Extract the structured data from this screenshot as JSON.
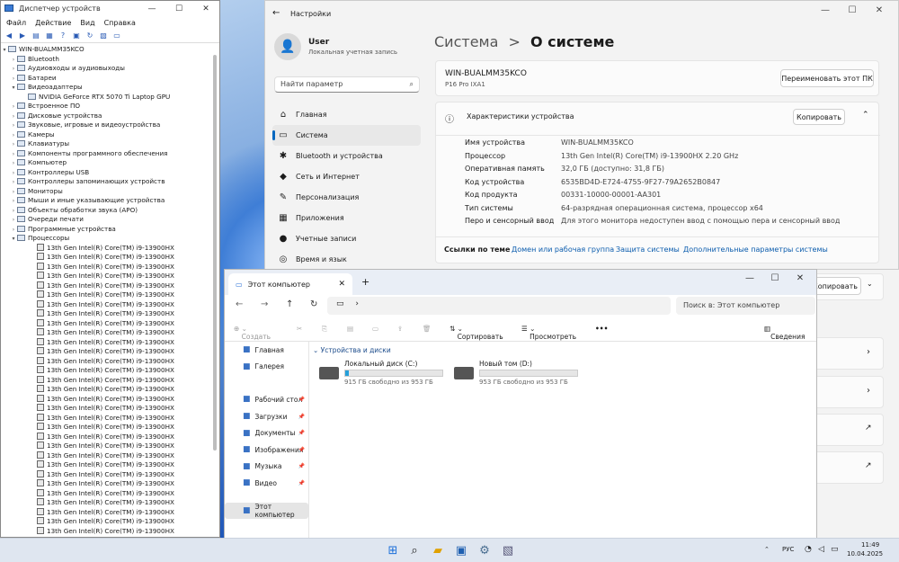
{
  "device_manager": {
    "title": "Диспетчер устройств",
    "menu": [
      "Файл",
      "Действие",
      "Вид",
      "Справка"
    ],
    "root": "WIN-BUALMM35KCO",
    "categories": [
      {
        "label": "Bluetooth",
        "expanded": false
      },
      {
        "label": "Аудиовходы и аудиовыходы",
        "expanded": false
      },
      {
        "label": "Батареи",
        "expanded": false
      },
      {
        "label": "Видеоадаптеры",
        "expanded": true
      },
      {
        "label": "NVIDIA GeForce RTX 5070 Ti Laptop GPU",
        "child": true
      },
      {
        "label": "Встроенное ПО",
        "expanded": false
      },
      {
        "label": "Дисковые устройства",
        "expanded": false
      },
      {
        "label": "Звуковые, игровые и видеоустройства",
        "expanded": false
      },
      {
        "label": "Камеры",
        "expanded": false
      },
      {
        "label": "Клавиатуры",
        "expanded": false
      },
      {
        "label": "Компоненты программного обеспечения",
        "expanded": false
      },
      {
        "label": "Компьютер",
        "expanded": false
      },
      {
        "label": "Контроллеры USB",
        "expanded": false
      },
      {
        "label": "Контроллеры запоминающих устройств",
        "expanded": false
      },
      {
        "label": "Мониторы",
        "expanded": false
      },
      {
        "label": "Мыши и иные указывающие устройства",
        "expanded": false
      },
      {
        "label": "Объекты обработки звука (APO)",
        "expanded": false
      },
      {
        "label": "Очереди печати",
        "expanded": false
      },
      {
        "label": "Программные устройства",
        "expanded": false
      },
      {
        "label": "Процессоры",
        "expanded": true
      }
    ],
    "processor_label": "13th Gen Intel(R) Core(TM) i9-13900HX",
    "processor_count": 31
  },
  "settings": {
    "window_title": "Настройки",
    "user_name": "User",
    "user_role": "Локальная учетная запись",
    "search_placeholder": "Найти параметр",
    "nav": [
      {
        "label": "Главная",
        "icon": "home-icon",
        "glyph": "⌂",
        "active": false
      },
      {
        "label": "Система",
        "icon": "system-icon",
        "glyph": "▭",
        "active": true
      },
      {
        "label": "Bluetooth и устройства",
        "icon": "bluetooth-icon",
        "glyph": "✱",
        "active": false
      },
      {
        "label": "Сеть и Интернет",
        "icon": "network-icon",
        "glyph": "◆",
        "active": false
      },
      {
        "label": "Персонализация",
        "icon": "brush-icon",
        "glyph": "✎",
        "active": false
      },
      {
        "label": "Приложения",
        "icon": "apps-icon",
        "glyph": "▦",
        "active": false
      },
      {
        "label": "Учетные записи",
        "icon": "account-icon",
        "glyph": "●",
        "active": false
      },
      {
        "label": "Время и язык",
        "icon": "globe-icon",
        "glyph": "◎",
        "active": false
      }
    ],
    "breadcrumb_parent": "Система",
    "breadcrumb_sep": ">",
    "breadcrumb_current": "О системе",
    "pc_name": "WIN-BUALMM35KCO",
    "pc_model": "P16 Pro IXA1",
    "rename_button": "Переименовать этот ПК",
    "specs_title": "Характеристики устройства",
    "copy_button": "Копировать",
    "copy_button2": "Копировать",
    "specs": [
      {
        "k": "Имя устройства",
        "v": "WIN-BUALMM35KCO"
      },
      {
        "k": "Процессор",
        "v": "13th Gen Intel(R) Core(TM) i9-13900HX   2.20 GHz"
      },
      {
        "k": "Оперативная память",
        "v": "32,0 ГБ (доступно: 31,8 ГБ)"
      },
      {
        "k": "Код устройства",
        "v": "6535BD4D-E724-4755-9F27-79A2652B0847"
      },
      {
        "k": "Код продукта",
        "v": "00331-10000-00001-AA301"
      },
      {
        "k": "Тип системы",
        "v": "64-разрядная операционная система, процессор x64"
      },
      {
        "k": "Перо и сенсорный ввод",
        "v": "Для этого монитора недоступен ввод с помощью пера и сенсорный ввод"
      }
    ],
    "related_title": "Ссылки по теме",
    "related_links": [
      "Домен или рабочая группа",
      "Защита системы",
      "Дополнительные параметры системы"
    ]
  },
  "explorer": {
    "tab_title": "Этот компьютер",
    "search_placeholder": "Поиск в: Этот компьютер",
    "cmd_create": "Создать",
    "cmd_sort": "Сортировать",
    "cmd_view": "Просмотреть",
    "cmd_more": "•••",
    "cmd_details": "Сведения",
    "section_title": "Устройства и диски",
    "sidebar": [
      {
        "label": "Главная",
        "icon": "home-icon",
        "pin": false
      },
      {
        "label": "Галерея",
        "icon": "gallery-icon",
        "pin": false
      },
      {
        "label": "Рабочий стол",
        "icon": "desktop-icon",
        "pin": true
      },
      {
        "label": "Загрузки",
        "icon": "downloads-icon",
        "pin": true
      },
      {
        "label": "Документы",
        "icon": "documents-icon",
        "pin": true
      },
      {
        "label": "Изображения",
        "icon": "pictures-icon",
        "pin": true
      },
      {
        "label": "Музыка",
        "icon": "music-icon",
        "pin": true
      },
      {
        "label": "Видео",
        "icon": "video-icon",
        "pin": true
      },
      {
        "label": "Этот компьютер",
        "icon": "computer-icon",
        "pin": false
      }
    ],
    "drives": [
      {
        "name": "Локальный диск (C:)",
        "free": "915 ГБ свободно из 953 ГБ",
        "used_fraction": 0.04
      },
      {
        "name": "Новый том (D:)",
        "free": "953 ГБ свободно из 953 ГБ",
        "used_fraction": 0.0
      }
    ]
  },
  "taskbar": {
    "lang": "РУС",
    "time": "11:49",
    "date": "10.04.2025"
  }
}
